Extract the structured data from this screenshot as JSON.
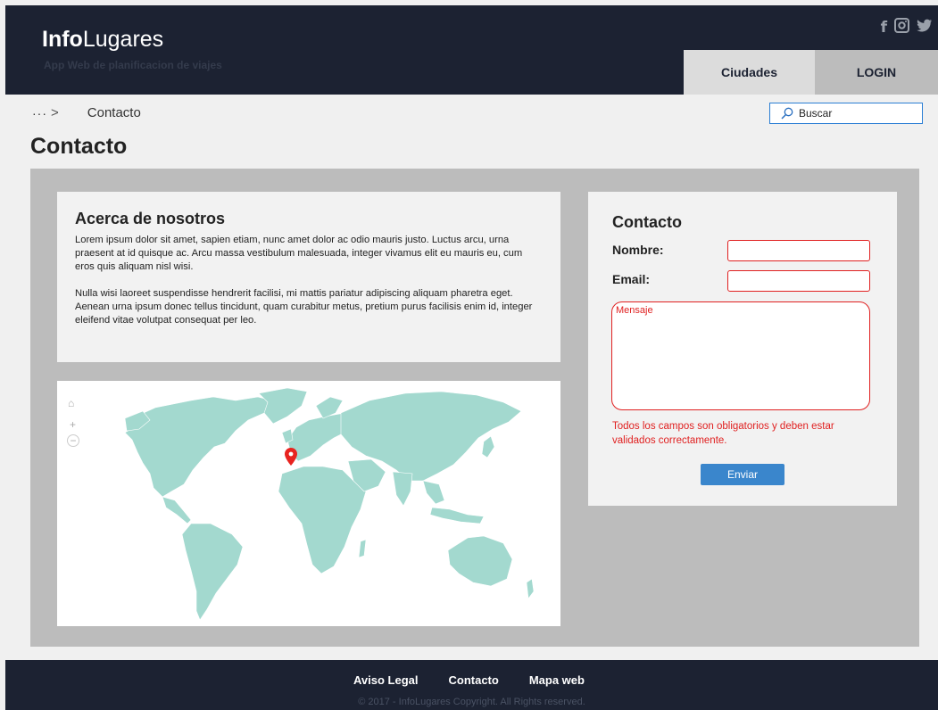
{
  "header": {
    "logo_bold": "Info",
    "logo_light": "Lugares",
    "tagline": "App Web de planificacion de viajes",
    "social": [
      {
        "icon": "facebook-icon",
        "glyph": "f"
      },
      {
        "icon": "instagram-icon",
        "glyph": "▣"
      },
      {
        "icon": "twitter-icon",
        "glyph": "🐦"
      }
    ],
    "nav": {
      "ciudades": "Ciudades",
      "login": "LOGIN"
    }
  },
  "breadcrumb": {
    "ellipsis": "···",
    "separator": ">",
    "current": "Contacto"
  },
  "search": {
    "placeholder": "Buscar",
    "icon": "search-icon"
  },
  "page_title": "Contacto",
  "about": {
    "title": "Acerca de nosotros",
    "paragraphs": [
      "Lorem ipsum dolor sit amet, sapien etiam, nunc amet dolor ac odio mauris justo. Luctus arcu, urna praesent at id quisque ac. Arcu massa vestibulum malesuada, integer vivamus elit eu mauris eu, cum eros quis aliquam nisl wisi.",
      "Nulla wisi laoreet suspendisse hendrerit facilisi, mi mattis pariatur adipiscing aliquam pharetra eget. Aenean urna ipsum donec tellus tincidunt, quam curabitur metus, pretium purus facilisis enim id, integer eleifend vitae volutpat consequat per leo."
    ]
  },
  "map": {
    "controls": {
      "home": "⌂",
      "zoom_in": "+",
      "zoom_out": "−"
    },
    "land_color": "#a3d9cf",
    "marker_color": "#e8231f"
  },
  "contact_form": {
    "title": "Contacto",
    "name_label": "Nombre:",
    "email_label": "Email:",
    "message_placeholder": "Mensaje",
    "error": "Todos los campos son obligatorios y deben estar validados correctamente.",
    "submit": "Enviar"
  },
  "footer": {
    "links": [
      "Aviso Legal",
      "Contacto",
      "Mapa web"
    ],
    "copyright": "© 2017 - InfoLugares Copyright. All Rights reserved."
  },
  "colors": {
    "header_bg": "#1c2232",
    "error_red": "#e02020",
    "button_blue": "#3a86cc"
  }
}
